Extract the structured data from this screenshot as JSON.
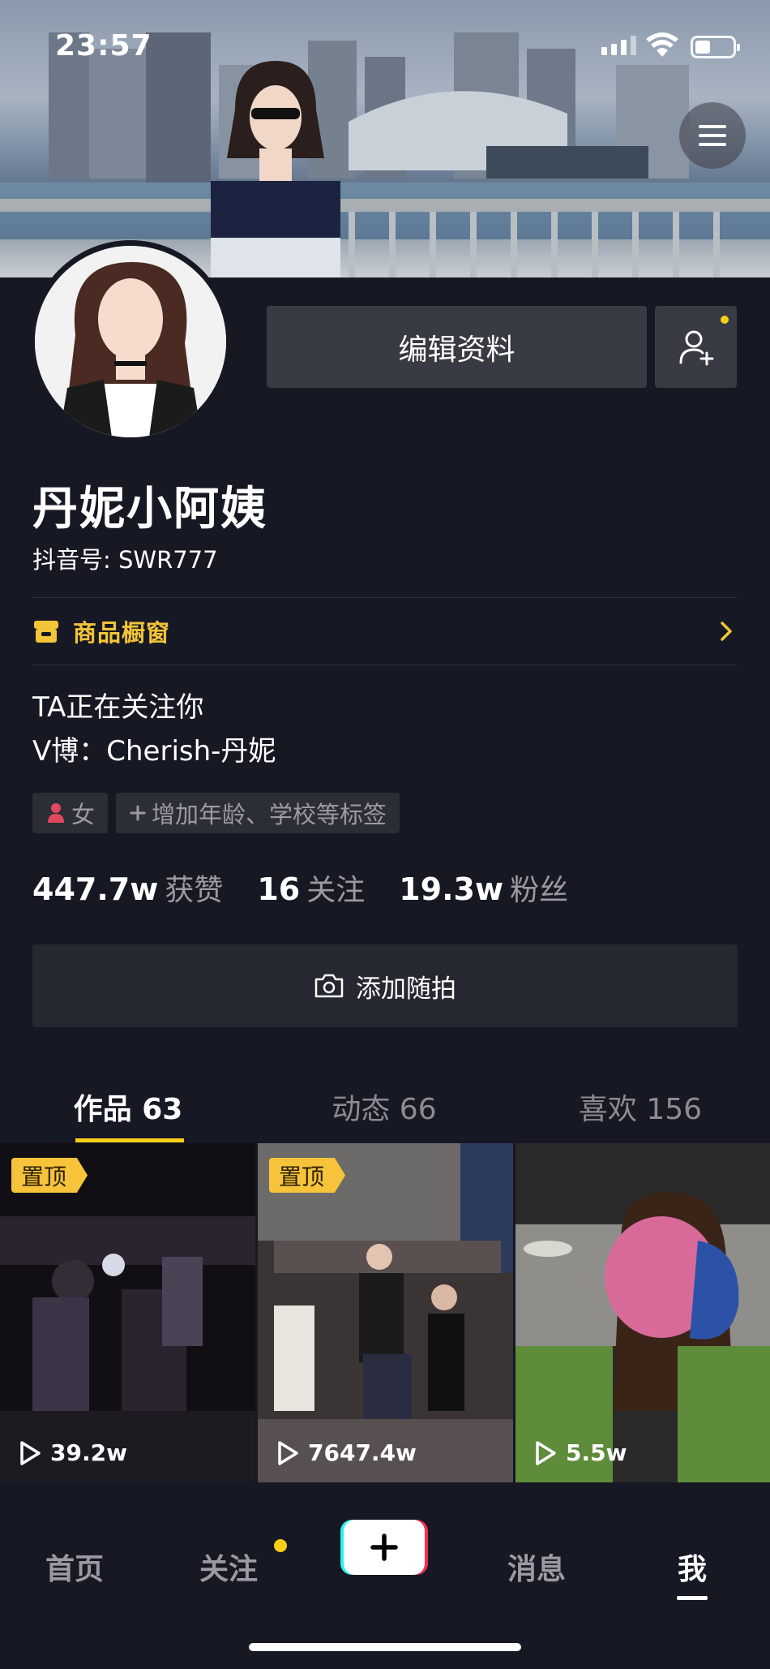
{
  "status_bar": {
    "time": "23:57"
  },
  "profile": {
    "edit_label": "编辑资料",
    "name": "丹妮小阿姨",
    "douyin_id": "抖音号: SWR777",
    "shop_label": "商品橱窗",
    "bio_line1": "TA正在关注你",
    "bio_line2": "V博：Cherish-丹妮",
    "tag_gender": "女",
    "tag_add": "增加年龄、学校等标签",
    "add_photo_label": "添加随拍"
  },
  "stats": [
    {
      "value": "447.7w",
      "label": "获赞"
    },
    {
      "value": "16",
      "label": "关注"
    },
    {
      "value": "19.3w",
      "label": "粉丝"
    }
  ],
  "tabs": [
    {
      "label": "作品 63",
      "active": true
    },
    {
      "label": "动态 66",
      "active": false
    },
    {
      "label": "喜欢 156",
      "active": false
    }
  ],
  "videos": [
    {
      "pinned": true,
      "pin_label": "置顶",
      "plays": "39.2w"
    },
    {
      "pinned": true,
      "pin_label": "置顶",
      "plays": "7647.4w"
    },
    {
      "pinned": false,
      "pin_label": "",
      "plays": "5.5w"
    }
  ],
  "bottom_nav": [
    {
      "label": "首页",
      "active": false
    },
    {
      "label": "关注",
      "active": false,
      "dot": true
    },
    {
      "label": "消息",
      "active": false
    },
    {
      "label": "我",
      "active": true
    }
  ],
  "colors": {
    "background": "#161823",
    "accent": "#face15",
    "shop": "#f2c437",
    "button": "#393b44"
  },
  "icons": [
    "menu-icon",
    "add-friend-icon",
    "shop-icon",
    "chevron-right-icon",
    "gender-female-icon",
    "plus-icon",
    "camera-icon",
    "play-icon",
    "create-plus-icon"
  ]
}
